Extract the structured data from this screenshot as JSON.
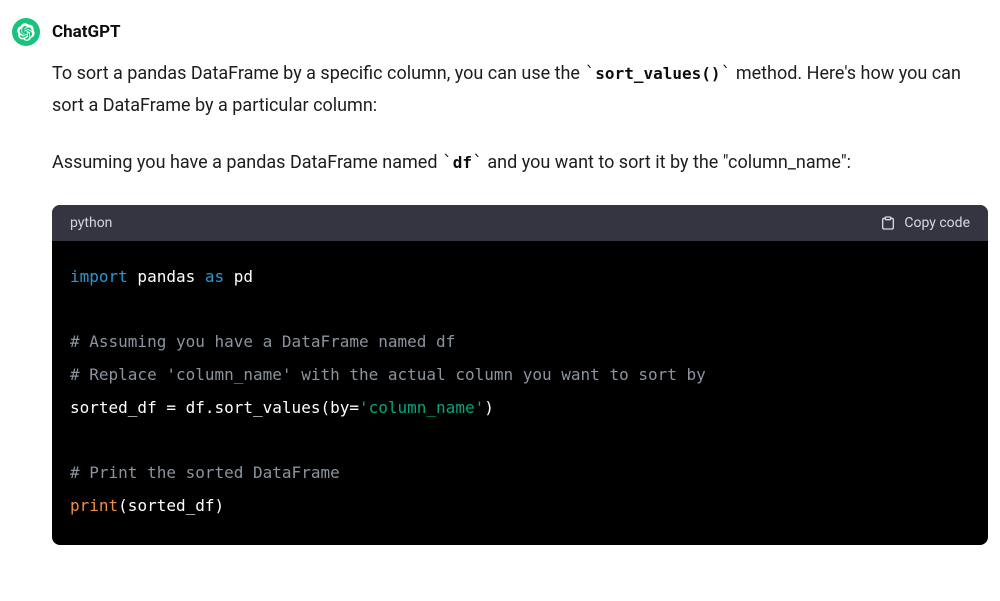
{
  "assistant": {
    "name": "ChatGPT"
  },
  "message": {
    "p1_a": "To sort a pandas DataFrame by a specific column, you can use the ",
    "p1_code": "sort_values()",
    "p1_b": " method. Here's how you can sort a DataFrame by a particular column:",
    "p2_a": "Assuming you have a pandas DataFrame named ",
    "p2_code": "df",
    "p2_b": " and you want to sort it by the \"column_name\":"
  },
  "codeblock": {
    "language": "python",
    "copy_label": "Copy code",
    "lines": {
      "l1_kw1": "import",
      "l1_txt1": " pandas ",
      "l1_kw2": "as",
      "l1_txt2": " pd",
      "l3_comment": "# Assuming you have a DataFrame named df",
      "l4_comment": "# Replace 'column_name' with the actual column you want to sort by",
      "l5_a": "sorted_df = df.sort_values(by=",
      "l5_str": "'column_name'",
      "l5_b": ")",
      "l7_comment": "# Print the sorted DataFrame",
      "l8_builtin": "print",
      "l8_rest": "(sorted_df)"
    }
  }
}
